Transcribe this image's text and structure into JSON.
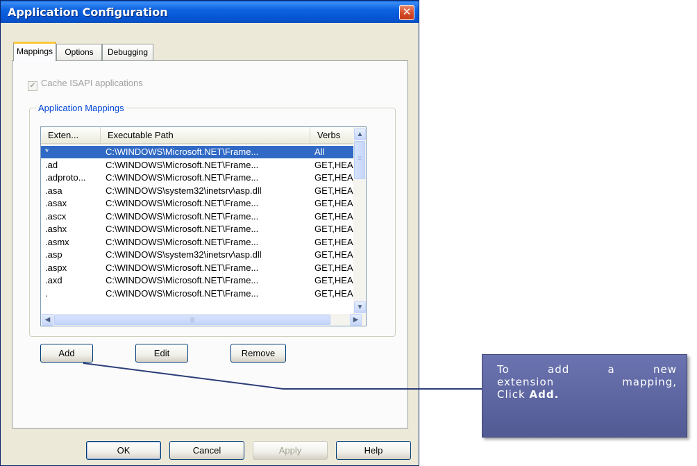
{
  "window": {
    "title": "Application Configuration",
    "close_glyph": "✕"
  },
  "tabs": [
    {
      "label": "Mappings",
      "active": true
    },
    {
      "label": "Options",
      "active": false
    },
    {
      "label": "Debugging",
      "active": false
    }
  ],
  "cache_checkbox": {
    "label": "Cache ISAPI applications",
    "checked": true,
    "enabled": false
  },
  "group": {
    "label": "Application Mappings"
  },
  "list": {
    "columns": [
      "Exten...",
      "Executable Path",
      "Verbs"
    ],
    "rows": [
      {
        "ext": "*",
        "path": "C:\\WINDOWS\\Microsoft.NET\\Frame...",
        "verbs": "All",
        "selected": true
      },
      {
        "ext": ".ad",
        "path": "C:\\WINDOWS\\Microsoft.NET\\Frame...",
        "verbs": "GET,HEA."
      },
      {
        "ext": ".adproto...",
        "path": "C:\\WINDOWS\\Microsoft.NET\\Frame...",
        "verbs": "GET,HEA."
      },
      {
        "ext": ".asa",
        "path": "C:\\WINDOWS\\system32\\inetsrv\\asp.dll",
        "verbs": "GET,HEA."
      },
      {
        "ext": ".asax",
        "path": "C:\\WINDOWS\\Microsoft.NET\\Frame...",
        "verbs": "GET,HEA."
      },
      {
        "ext": ".ascx",
        "path": "C:\\WINDOWS\\Microsoft.NET\\Frame...",
        "verbs": "GET,HEA."
      },
      {
        "ext": ".ashx",
        "path": "C:\\WINDOWS\\Microsoft.NET\\Frame...",
        "verbs": "GET,HEA."
      },
      {
        "ext": ".asmx",
        "path": "C:\\WINDOWS\\Microsoft.NET\\Frame...",
        "verbs": "GET,HEA."
      },
      {
        "ext": ".asp",
        "path": "C:\\WINDOWS\\system32\\inetsrv\\asp.dll",
        "verbs": "GET,HEA."
      },
      {
        "ext": ".aspx",
        "path": "C:\\WINDOWS\\Microsoft.NET\\Frame...",
        "verbs": "GET,HEA."
      },
      {
        "ext": ".axd",
        "path": "C:\\WINDOWS\\Microsoft.NET\\Frame...",
        "verbs": "GET,HEA."
      },
      {
        "ext": ".",
        "path": "C:\\WINDOWS\\Microsoft.NET\\Frame...",
        "verbs": "GET,HEA."
      }
    ],
    "scroll_glyphs": {
      "up": "▲",
      "down": "▼",
      "left": "◀",
      "right": "▶",
      "grip": "≡",
      "hgrip": "|||"
    }
  },
  "mapping_buttons": {
    "add": "Add",
    "edit": "Edit",
    "remove": "Remove"
  },
  "footer_buttons": {
    "ok": "OK",
    "cancel": "Cancel",
    "apply": "Apply",
    "help": "Help"
  },
  "callout": {
    "line1": [
      "To",
      "add",
      "a",
      "new"
    ],
    "line2": [
      "extension",
      "mapping,"
    ],
    "line3_prefix": "Click ",
    "line3_bold": "Add."
  },
  "colors": {
    "titlebar": "#0a5fd8",
    "selection": "#316ac5",
    "callout_bg": "#5f68a3",
    "connector": "#2c3e78"
  }
}
